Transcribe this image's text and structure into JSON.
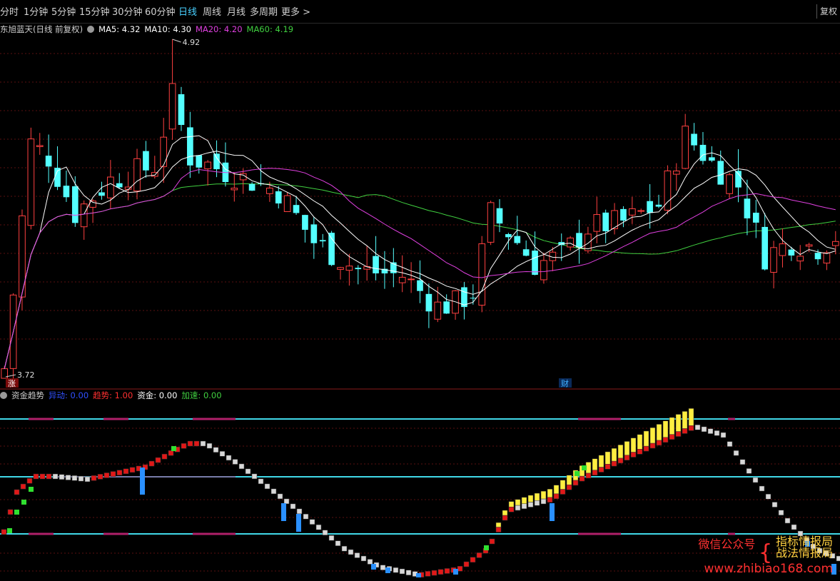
{
  "toolbar": {
    "tabs": [
      "分时",
      "1分钟",
      "5分钟",
      "15分钟",
      "30分钟",
      "60分钟",
      "日线",
      "周线",
      "月线",
      "多周期",
      "更多 >"
    ],
    "active_tab": "日线",
    "restore_label": "复权"
  },
  "main_legend": {
    "stock_name": "东旭蓝天(日线 前复权)",
    "ma5": "MA5: 4.32",
    "ma10": "MA10: 4.30",
    "ma20": "MA20: 4.20",
    "ma60": "MA60: 4.19",
    "colors": {
      "ma5": "#ffffff",
      "ma10": "#ffffff",
      "ma20": "#e040e0",
      "ma60": "#40d040"
    }
  },
  "annotations": {
    "high_label": "4.92",
    "low_label": "3.72",
    "rise_tag": "涨",
    "finance_tag": "财"
  },
  "sub_legend": {
    "title": "资金趋势",
    "yidong": "异动: 0.00",
    "qushi": "趋势: 1.00",
    "zijin": "资金: 0.00",
    "jiasu": "加速: 0.00",
    "colors": {
      "yidong": "#3050ff",
      "qushi": "#ff3030",
      "zijin": "#ffffff",
      "jiasu": "#40d040"
    }
  },
  "watermark": {
    "label": "微信公众号",
    "line1": "指标情报局",
    "line2": "战法情报局",
    "url": "www.zhibiao168.com"
  },
  "chart_data": {
    "type": "candlestick",
    "price_axis": {
      "low": 3.72,
      "high": 4.92
    },
    "up_color": "#ff4040",
    "down_color": "#54ffff",
    "ma_series": [
      {
        "name": "MA5",
        "last": 4.32
      },
      {
        "name": "MA10",
        "last": 4.3
      },
      {
        "name": "MA20",
        "last": 4.2
      },
      {
        "name": "MA60",
        "last": 4.19
      }
    ]
  }
}
